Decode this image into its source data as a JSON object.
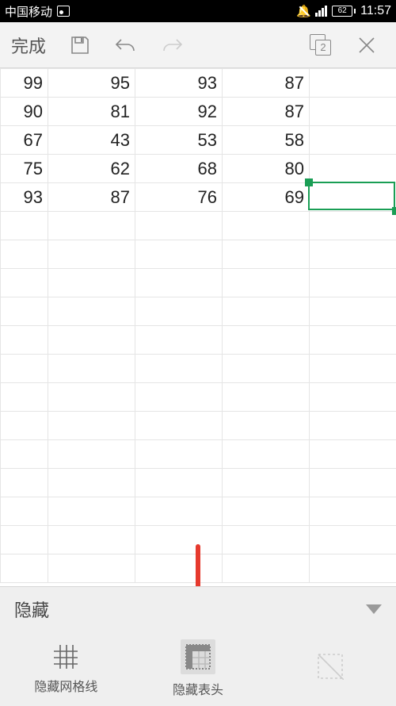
{
  "status_bar": {
    "carrier": "中国移动",
    "battery": "62",
    "time": "11:57"
  },
  "toolbar": {
    "done_label": "完成",
    "duplicate_count": "2"
  },
  "sheet": {
    "rows": [
      [
        "99",
        "95",
        "93",
        "87",
        ""
      ],
      [
        "90",
        "81",
        "92",
        "87",
        ""
      ],
      [
        "67",
        "43",
        "53",
        "58",
        ""
      ],
      [
        "75",
        "62",
        "68",
        "80",
        ""
      ],
      [
        "93",
        "87",
        "76",
        "69",
        ""
      ],
      [
        "",
        "",
        "",
        "",
        ""
      ],
      [
        "",
        "",
        "",
        "",
        ""
      ],
      [
        "",
        "",
        "",
        "",
        ""
      ],
      [
        "",
        "",
        "",
        "",
        ""
      ],
      [
        "",
        "",
        "",
        "",
        ""
      ],
      [
        "",
        "",
        "",
        "",
        ""
      ],
      [
        "",
        "",
        "",
        "",
        ""
      ],
      [
        "",
        "",
        "",
        "",
        ""
      ],
      [
        "",
        "",
        "",
        "",
        ""
      ],
      [
        "",
        "",
        "",
        "",
        ""
      ],
      [
        "",
        "",
        "",
        "",
        ""
      ],
      [
        "",
        "",
        "",
        "",
        ""
      ],
      [
        "",
        "",
        "",
        "",
        ""
      ]
    ],
    "selected": {
      "row": 4,
      "col": 4
    }
  },
  "panel": {
    "title": "隐藏",
    "options": [
      {
        "label": "隐藏网格线",
        "icon": "grid",
        "selected": false,
        "disabled": false
      },
      {
        "label": "隐藏表头",
        "icon": "header",
        "selected": true,
        "disabled": false
      },
      {
        "label": "",
        "icon": "crop",
        "selected": false,
        "disabled": true
      }
    ]
  }
}
